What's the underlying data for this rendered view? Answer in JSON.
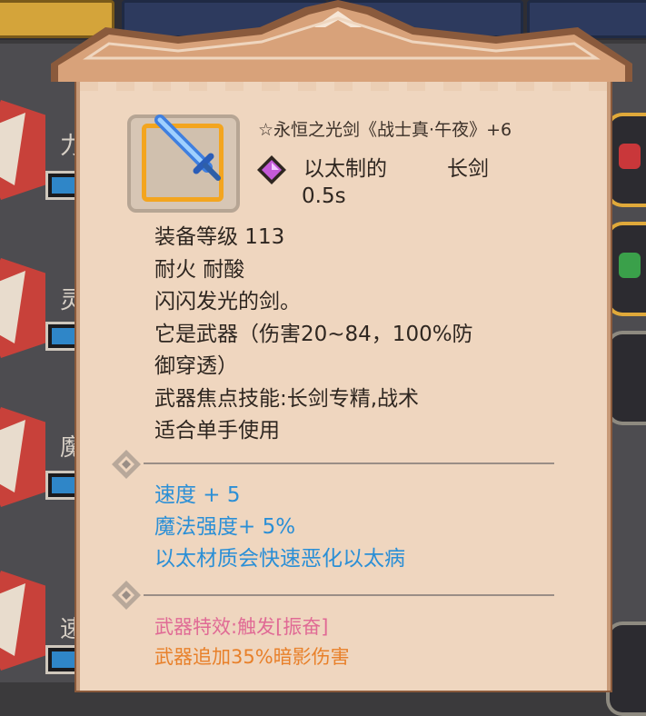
{
  "item": {
    "name": "☆永恒之光剑《战士真·午夜》+6",
    "material_label": "以太制的",
    "type_label": "长剑",
    "attack_speed": "0.5s"
  },
  "description": [
    "装备等级 113",
    "耐火 耐酸",
    "闪闪发光的剑。",
    "它是武器（伤害20~84，100%防",
    "御穿透）",
    "武器焦点技能:长剑专精,战术",
    "适合单手使用"
  ],
  "bonuses": [
    "速度 + 5",
    "魔法强度+ 5%",
    "以太材质会快速恶化以太病"
  ],
  "effects": [
    {
      "text": "武器特效:触发[振奋]",
      "color": "#e06a95"
    },
    {
      "text": "武器追加35%暗影伤害",
      "color": "#e8802a"
    }
  ],
  "background": {
    "stat_labels": [
      "力",
      "灵",
      "魔",
      "速"
    ]
  },
  "colors": {
    "tooltip_bg": "#efd6bf",
    "bonus_blue": "#2b8fd6",
    "frame_gold": "#f3a51f"
  },
  "icons": {
    "item": "sword-icon",
    "material": "purple-gem-icon",
    "divider": "diamond-icon"
  }
}
